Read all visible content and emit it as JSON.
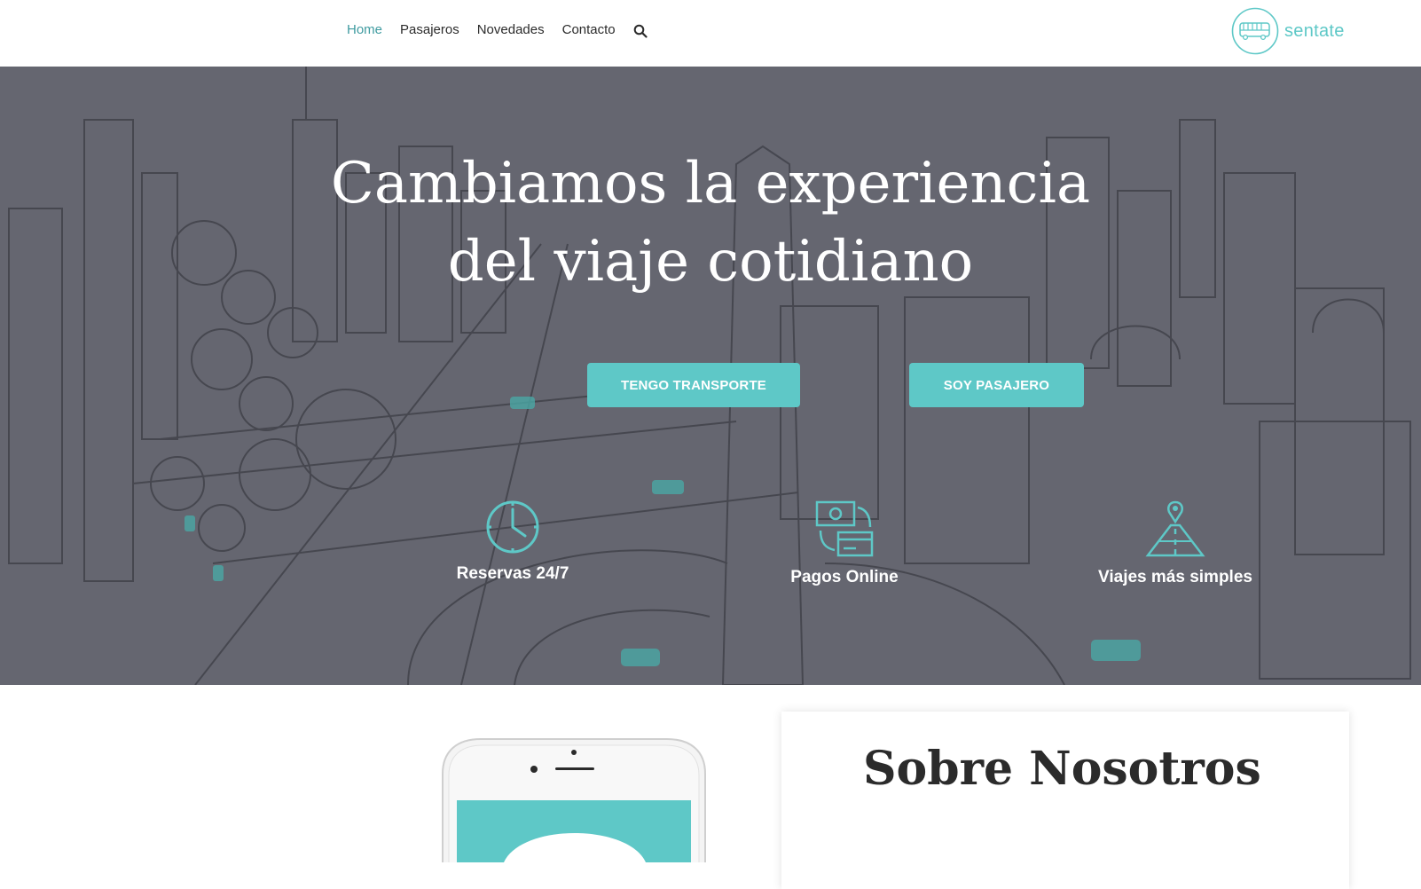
{
  "nav": {
    "items": [
      {
        "label": "Home",
        "active": true
      },
      {
        "label": "Pasajeros",
        "active": false
      },
      {
        "label": "Novedades",
        "active": false
      },
      {
        "label": "Contacto",
        "active": false
      }
    ],
    "search_icon": "search-icon"
  },
  "brand": {
    "name": "sentate",
    "icon": "bus-icon"
  },
  "hero": {
    "title_line1": "Cambiamos la experiencia",
    "title_line2": "del viaje cotidiano",
    "buttons": {
      "transport": "TENGO TRANSPORTE",
      "passenger": "SOY PASAJERO"
    },
    "features": [
      {
        "label": "Reservas 24/7",
        "icon": "clock-icon"
      },
      {
        "label": "Pagos Online",
        "icon": "money-card-icon"
      },
      {
        "label": "Viajes más simples",
        "icon": "map-road-pin-icon"
      }
    ]
  },
  "about": {
    "title": "Sobre Nosotros"
  },
  "colors": {
    "accent": "#5ec8c7",
    "active_link": "#3f9ba0",
    "hero_overlay": "#656670",
    "text_dark": "#2b2b2b"
  }
}
